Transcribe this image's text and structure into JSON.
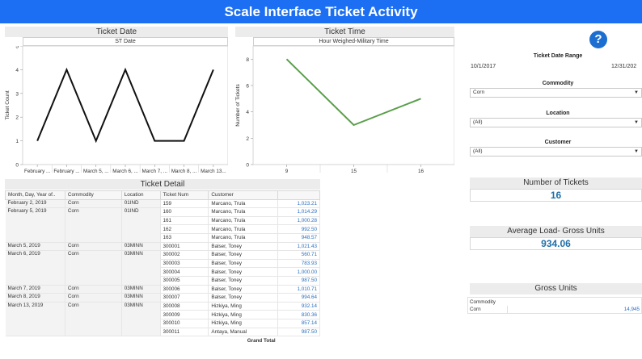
{
  "header": {
    "title": "Scale Interface Ticket Activity"
  },
  "ticket_date_panel": {
    "title": "Ticket Date",
    "subtitle": "ST Date"
  },
  "ticket_time_panel": {
    "title": "Ticket Time",
    "subtitle": "Hour Weighed-Military Time"
  },
  "chart_data": [
    {
      "type": "line",
      "title": "Ticket Date",
      "subtitle": "ST Date",
      "ylabel": "Ticket Count",
      "xlabel": "",
      "categories": [
        "February ...",
        "February ...",
        "March 5, ...",
        "March 6, ...",
        "March 7, ...",
        "March 8, ...",
        "March 13..."
      ],
      "values": [
        1,
        4,
        1,
        4,
        1,
        1,
        4
      ],
      "ylim": [
        0,
        5
      ],
      "yticks": [
        0,
        1,
        2,
        3,
        4,
        5
      ],
      "color": "#111111",
      "grid": false
    },
    {
      "type": "line",
      "title": "Ticket Time",
      "subtitle": "Hour Weighed-Military Time",
      "ylabel": "Number of Tickets",
      "xlabel": "",
      "categories": [
        "9",
        "15",
        "16"
      ],
      "values": [
        8,
        3,
        5
      ],
      "ylim": [
        0,
        9
      ],
      "yticks": [
        0,
        2,
        4,
        6,
        8
      ],
      "color": "#5a9e4a",
      "grid": false
    }
  ],
  "ticket_detail": {
    "title": "Ticket Detail",
    "columns": [
      "Month, Day, Year of..",
      "Commodity",
      "Location",
      "Ticket Num",
      "Customer",
      ""
    ],
    "groups": [
      {
        "date": "February 2, 2019",
        "commodity": "Corn",
        "location": "01IND",
        "rows": [
          {
            "ticket": "159",
            "customer": "Marcano, Trula",
            "value": "1,023.21"
          }
        ]
      },
      {
        "date": "February 5, 2019",
        "commodity": "Corn",
        "location": "01IND",
        "rows": [
          {
            "ticket": "160",
            "customer": "Marcano, Trula",
            "value": "1,014.29"
          },
          {
            "ticket": "161",
            "customer": "Marcano, Trula",
            "value": "1,000.28"
          },
          {
            "ticket": "162",
            "customer": "Marcano, Trula",
            "value": "992.50"
          },
          {
            "ticket": "163",
            "customer": "Marcano, Trula",
            "value": "948.57"
          }
        ]
      },
      {
        "date": "March 5, 2019",
        "commodity": "Corn",
        "location": "03MINN",
        "rows": [
          {
            "ticket": "300001",
            "customer": "Balser, Toney",
            "value": "1,021.43"
          }
        ]
      },
      {
        "date": "March 6, 2019",
        "commodity": "Corn",
        "location": "03MINN",
        "rows": [
          {
            "ticket": "300002",
            "customer": "Balser, Toney",
            "value": "560.71"
          },
          {
            "ticket": "300003",
            "customer": "Balser, Toney",
            "value": "783.93"
          },
          {
            "ticket": "300004",
            "customer": "Balser, Toney",
            "value": "1,000.00"
          },
          {
            "ticket": "300005",
            "customer": "Balser, Toney",
            "value": "987.50"
          }
        ]
      },
      {
        "date": "March 7, 2019",
        "commodity": "Corn",
        "location": "03MINN",
        "rows": [
          {
            "ticket": "300006",
            "customer": "Balser, Toney",
            "value": "1,010.71"
          }
        ]
      },
      {
        "date": "March 8, 2019",
        "commodity": "Corn",
        "location": "03MINN",
        "rows": [
          {
            "ticket": "300007",
            "customer": "Balser, Toney",
            "value": "994.64"
          }
        ]
      },
      {
        "date": "March 13, 2019",
        "commodity": "Corn",
        "location": "03MINN",
        "rows": [
          {
            "ticket": "300008",
            "customer": "Hizkiya, Ming",
            "value": "932.14"
          },
          {
            "ticket": "300009",
            "customer": "Hizkiya, Ming",
            "value": "830.36"
          },
          {
            "ticket": "300010",
            "customer": "Hizkiya, Ming",
            "value": "857.14"
          },
          {
            "ticket": "300011",
            "customer": "Antaya, Manual",
            "value": "987.50"
          }
        ]
      }
    ],
    "grand_total_label": "Grand Total"
  },
  "filters": {
    "help_label": "?",
    "date_range": {
      "label": "Ticket Date Range",
      "start": "10/1/2017",
      "end": "12/31/202"
    },
    "commodity": {
      "label": "Commodity",
      "value": "Corn"
    },
    "location": {
      "label": "Location",
      "value": "(All)"
    },
    "customer": {
      "label": "Customer",
      "value": "(All)"
    }
  },
  "kpis": {
    "num_tickets": {
      "title": "Number of Tickets",
      "value": "16"
    },
    "avg_load": {
      "title": "Average Load- Gross Units",
      "value": "934.06"
    }
  },
  "gross_units": {
    "title": "Gross Units",
    "header": "Commodity",
    "row_label": "Corn",
    "row_value": "14,945"
  },
  "colors": {
    "banner": "#1c6ff2",
    "accent_text": "#1f6fa8",
    "line_date": "#111111",
    "line_time": "#5a9e4a"
  }
}
